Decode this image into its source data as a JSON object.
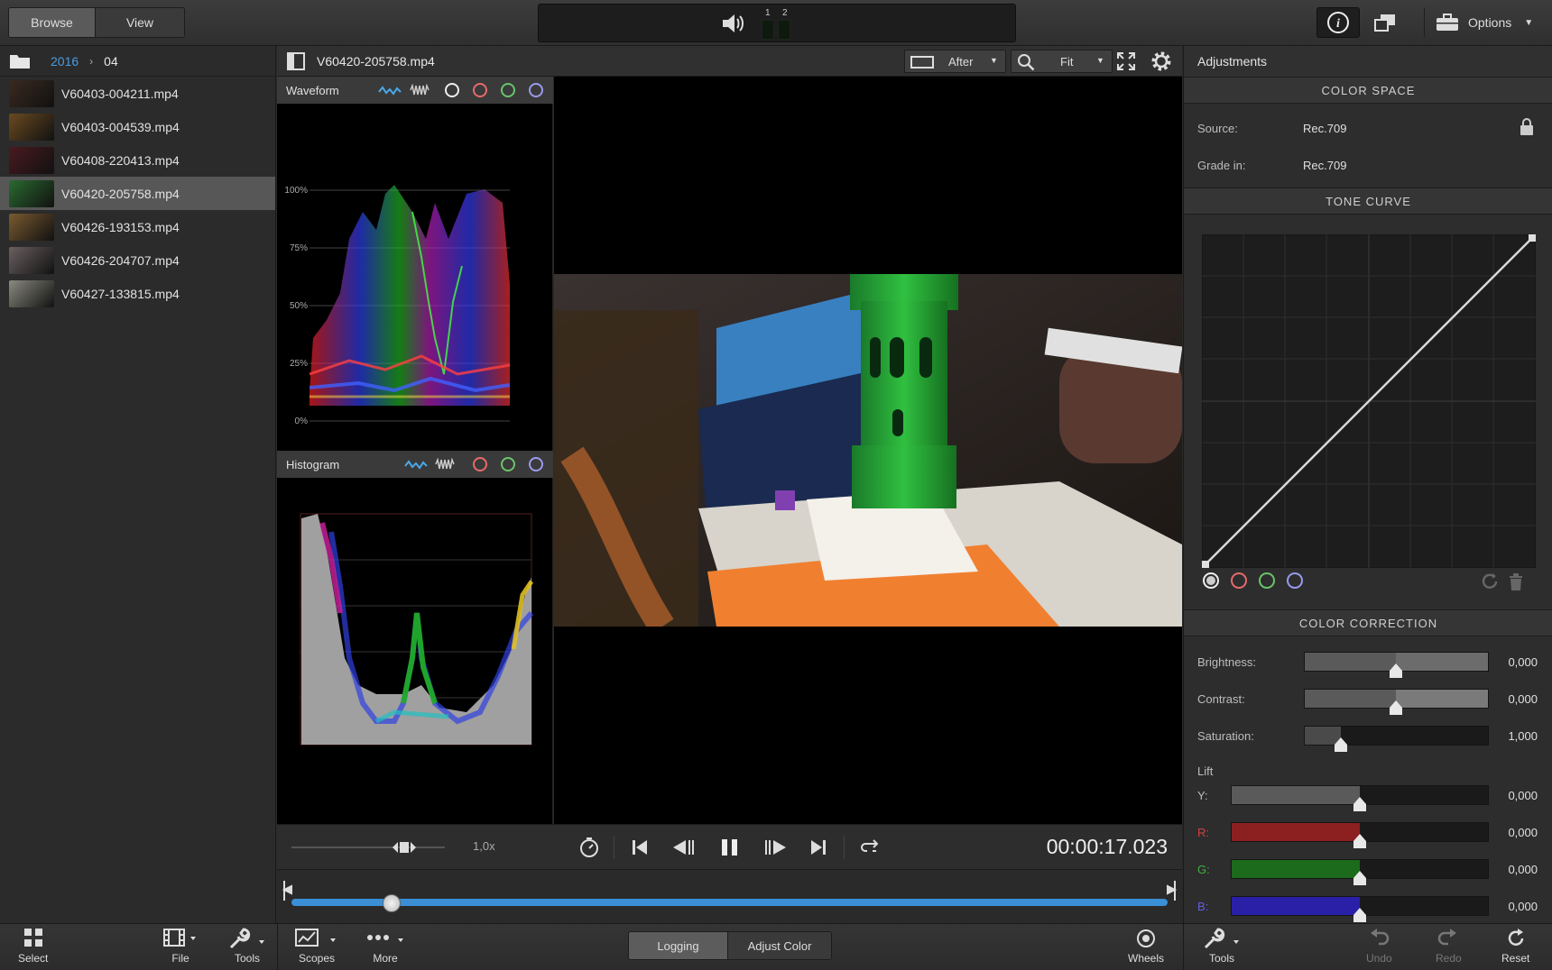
{
  "topbar": {
    "browse_label": "Browse",
    "view_label": "View",
    "channel_1": "1",
    "channel_2": "2",
    "options_label": "Options"
  },
  "breadcrumb": {
    "year": "2016",
    "month": "04"
  },
  "files": [
    {
      "name": "V60403-004211.mp4",
      "thumb": "#3a2a20",
      "selected": false
    },
    {
      "name": "V60403-004539.mp4",
      "thumb": "#6a4a20",
      "selected": false
    },
    {
      "name": "V60408-220413.mp4",
      "thumb": "#4a1a20",
      "selected": false
    },
    {
      "name": "V60420-205758.mp4",
      "thumb": "#2a6a30",
      "selected": true
    },
    {
      "name": "V60426-193153.mp4",
      "thumb": "#7a5a30",
      "selected": false
    },
    {
      "name": "V60426-204707.mp4",
      "thumb": "#6a6060",
      "selected": false
    },
    {
      "name": "V60427-133815.mp4",
      "thumb": "#8a8a80",
      "selected": false
    }
  ],
  "viewer": {
    "filename": "V60420-205758.mp4",
    "compare_label": "After",
    "zoom_label": "Fit"
  },
  "scopes": {
    "waveform_title": "Waveform",
    "waveform_ticks": [
      "100%",
      "75%",
      "50%",
      "25%",
      "0%"
    ],
    "histogram_title": "Histogram"
  },
  "transport": {
    "speed": "1,0x",
    "timecode": "00:00:17.023",
    "playhead_fraction": 0.07
  },
  "adjustments": {
    "title": "Adjustments",
    "color_space_header": "COLOR SPACE",
    "source_label": "Source:",
    "source_value": "Rec.709",
    "grade_label": "Grade in:",
    "grade_value": "Rec.709",
    "tone_curve_header": "TONE CURVE",
    "color_correction_header": "COLOR CORRECTION",
    "brightness_label": "Brightness:",
    "brightness_value": "0,000",
    "contrast_label": "Contrast:",
    "contrast_value": "0,000",
    "saturation_label": "Saturation:",
    "saturation_value": "1,000",
    "lift_label": "Lift",
    "lift_y_label": "Y:",
    "lift_y_value": "0,000",
    "lift_r_label": "R:",
    "lift_r_value": "0,000",
    "lift_g_label": "G:",
    "lift_g_value": "0,000",
    "lift_b_label": "B:",
    "lift_b_value": "0,000"
  },
  "bottom": {
    "select": "Select",
    "file": "File",
    "tools": "Tools",
    "scopes": "Scopes",
    "more": "More",
    "logging": "Logging",
    "adjust_color": "Adjust Color",
    "wheels": "Wheels",
    "tools_right": "Tools",
    "undo": "Undo",
    "redo": "Redo",
    "reset": "Reset"
  },
  "colors": {
    "accent_blue": "#3a8fd6",
    "lift_red": "#8c1f1f",
    "lift_green": "#1c6a1c",
    "lift_blue": "#2a20a8"
  }
}
